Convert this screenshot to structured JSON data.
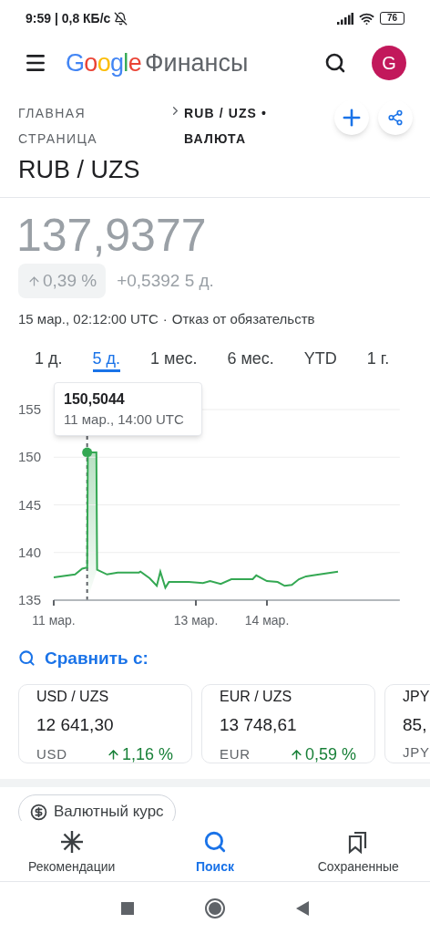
{
  "status_bar": {
    "time": "9:59 | 0,8 КБ/с",
    "battery": "76"
  },
  "header": {
    "logo": "Google",
    "title": "Финансы",
    "avatar": "G"
  },
  "breadcrumb": {
    "home": "ГЛАВНАЯ СТРАНИЦА",
    "current": "RUB / UZS • ВАЛЮТА"
  },
  "pair_title": "RUB / UZS",
  "price": "137,9377",
  "change_percent": "0,39 %",
  "change_value": "+0,5392 5 д.",
  "timestamp": "15 мар., 02:12:00 UTC",
  "separator": "·",
  "disclaimer": "Отказ от обязательств",
  "ranges": [
    {
      "label": "1 д.",
      "selected": false
    },
    {
      "label": "5 д.",
      "selected": true
    },
    {
      "label": "1 мес.",
      "selected": false
    },
    {
      "label": "6 мес.",
      "selected": false
    },
    {
      "label": "YTD",
      "selected": false
    },
    {
      "label": "1 г.",
      "selected": false
    }
  ],
  "tooltip": {
    "value": "150,5044",
    "time": "11 мар., 14:00 UTC"
  },
  "chart_data": {
    "type": "line",
    "grid": true,
    "xlim": [
      11,
      15.87
    ],
    "ylim": [
      135,
      155
    ],
    "yticks": [
      135,
      140,
      145,
      150,
      155
    ],
    "xticks": [
      {
        "value": 11,
        "label": "11 мар."
      },
      {
        "value": 13,
        "label": "13 мар."
      },
      {
        "value": 14,
        "label": "14 мар."
      }
    ],
    "x": [
      11,
      11.3,
      11.4,
      11.45,
      11.47,
      11.48,
      11.6,
      11.61,
      11.75,
      11.9,
      12.2,
      12.22,
      12.35,
      12.45,
      12.5,
      12.57,
      12.62,
      12.9,
      13.1,
      13.2,
      13.35,
      13.5,
      13.8,
      13.85,
      14.0,
      14.15,
      14.25,
      14.35,
      14.45,
      14.55,
      14.65,
      15.0
    ],
    "series": [
      {
        "color": "#34a853",
        "values": [
          137.4,
          137.7,
          138.3,
          138.4,
          138.4,
          150.5,
          150.5,
          138.2,
          137.7,
          137.9,
          137.9,
          138.0,
          137.3,
          136.5,
          138.0,
          136.3,
          136.9,
          136.9,
          136.8,
          137.0,
          136.7,
          137.2,
          137.2,
          137.6,
          137.0,
          136.9,
          136.5,
          136.6,
          137.2,
          137.5,
          137.6,
          138.0
        ]
      }
    ]
  },
  "compare": {
    "label": "Сравнить с:",
    "cards": [
      {
        "pair": "USD / UZS",
        "price": "12 641,30",
        "currency": "USD",
        "change": "1,16 %"
      },
      {
        "pair": "EUR / UZS",
        "price": "13 748,61",
        "currency": "EUR",
        "change": "0,59 %"
      },
      {
        "pair": "JPY",
        "price": "85,",
        "currency": "JPY"
      }
    ]
  },
  "chip": "Валютный курс",
  "bottom_nav": [
    {
      "kind": "sparkle",
      "label": "Рекомендации",
      "selected": false
    },
    {
      "kind": "search",
      "label": "Поиск",
      "selected": true
    },
    {
      "kind": "saved",
      "label": "Сохраненные",
      "selected": false
    }
  ]
}
